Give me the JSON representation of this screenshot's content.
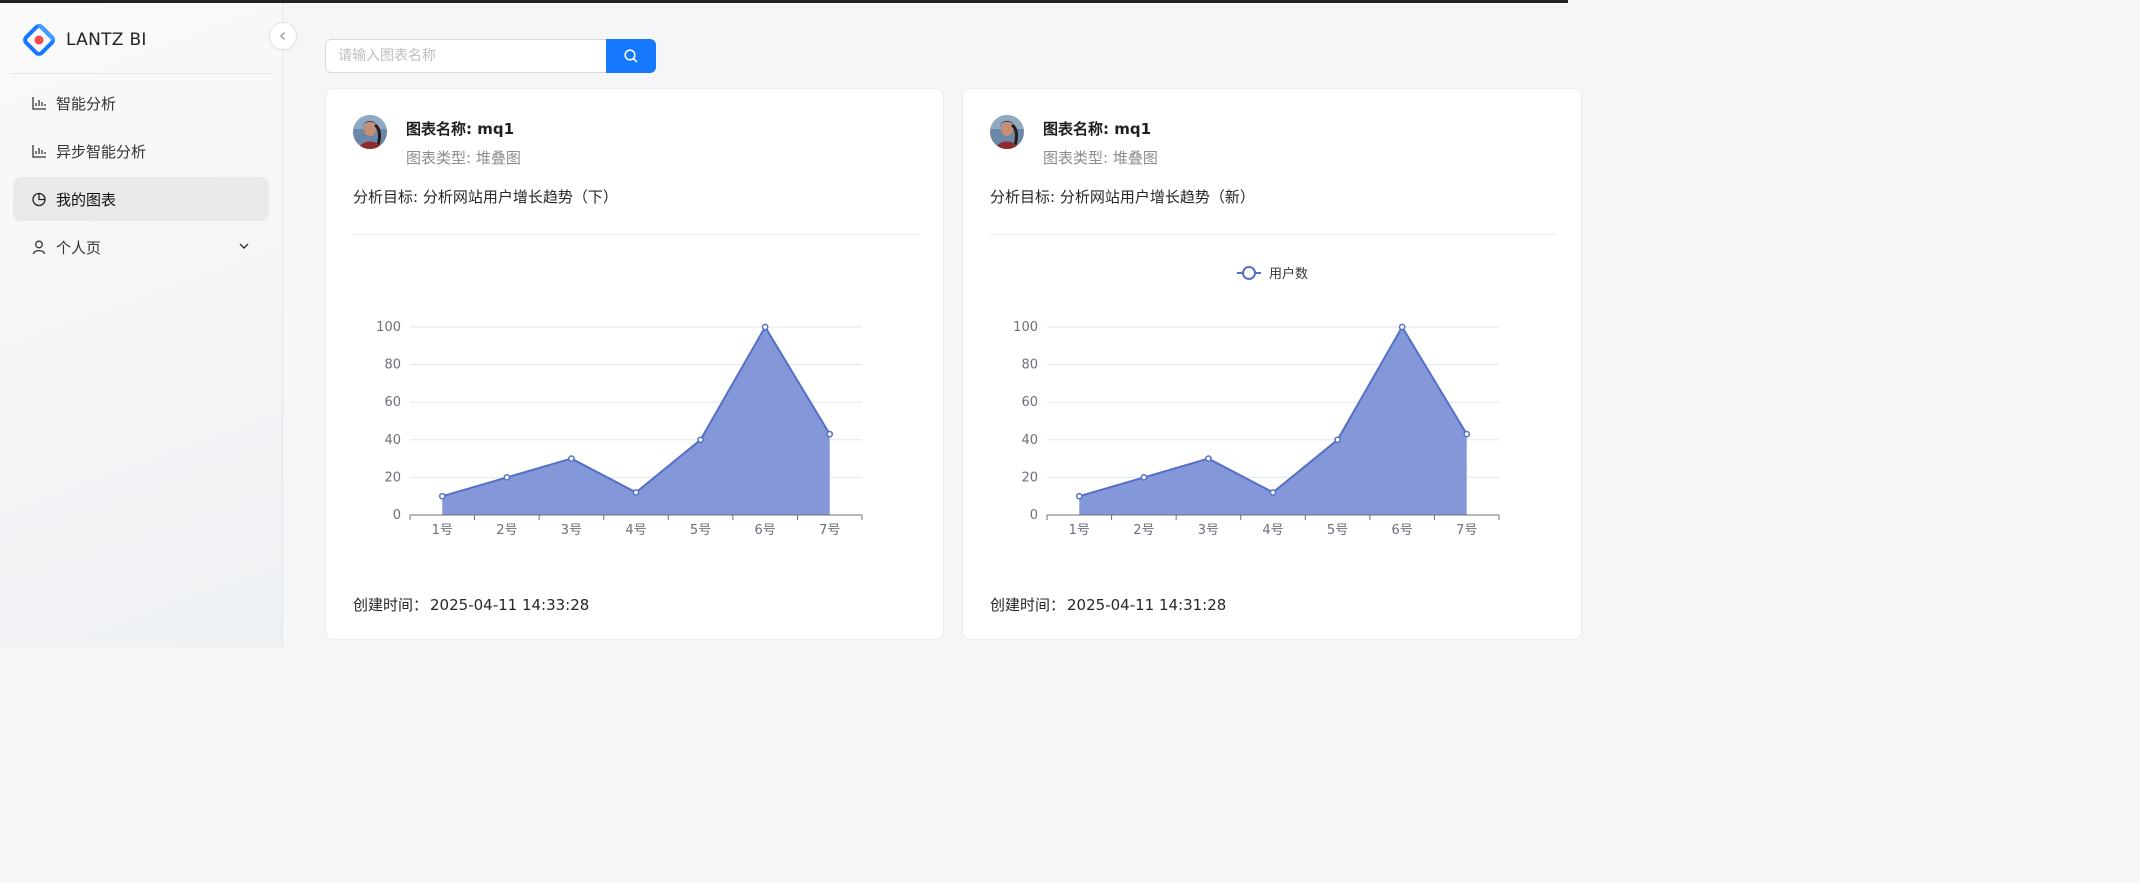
{
  "app": {
    "logo_text": "LANTZ BI"
  },
  "sidebar": {
    "items": [
      {
        "label": "智能分析",
        "icon": "bar-chart-icon"
      },
      {
        "label": "异步智能分析",
        "icon": "bar-chart-icon"
      },
      {
        "label": "我的图表",
        "icon": "pie-chart-icon",
        "active": true
      },
      {
        "label": "个人页",
        "icon": "user-icon",
        "has_submenu": true
      }
    ]
  },
  "search": {
    "placeholder": "请输入图表名称",
    "value": ""
  },
  "cards": [
    {
      "title_prefix": "图表名称: ",
      "title": "mq1",
      "type_prefix": "图表类型: ",
      "type": "堆叠图",
      "goal_prefix": "分析目标: ",
      "goal": "分析网站用户增长趋势（下）",
      "time_prefix": "创建时间：",
      "time": "2025-04-11 14:33:28"
    },
    {
      "title_prefix": "图表名称: ",
      "title": "mq1",
      "type_prefix": "图表类型: ",
      "type": "堆叠图",
      "goal_prefix": "分析目标: ",
      "goal": "分析网站用户增长趋势（新）",
      "time_prefix": "创建时间：",
      "time": "2025-04-11 14:31:28"
    }
  ],
  "chart_data": [
    {
      "type": "area",
      "categories": [
        "1号",
        "2号",
        "3号",
        "4号",
        "5号",
        "6号",
        "7号"
      ],
      "series": [
        {
          "values": [
            10,
            20,
            30,
            12,
            40,
            100,
            43
          ]
        }
      ],
      "ylim": [
        0,
        100
      ],
      "yticks": [
        0,
        20,
        40,
        60,
        80,
        100
      ],
      "legend": "none",
      "grid": true,
      "color": "#5470c6",
      "fill": "#8497d8"
    },
    {
      "type": "area",
      "categories": [
        "1号",
        "2号",
        "3号",
        "4号",
        "5号",
        "6号",
        "7号"
      ],
      "series": [
        {
          "name": "用户数",
          "values": [
            10,
            20,
            30,
            12,
            40,
            100,
            43
          ]
        }
      ],
      "ylim": [
        0,
        100
      ],
      "yticks": [
        0,
        20,
        40,
        60,
        80,
        100
      ],
      "legend": "top-center",
      "grid": true,
      "color": "#5470c6",
      "fill": "#8497d8"
    }
  ]
}
